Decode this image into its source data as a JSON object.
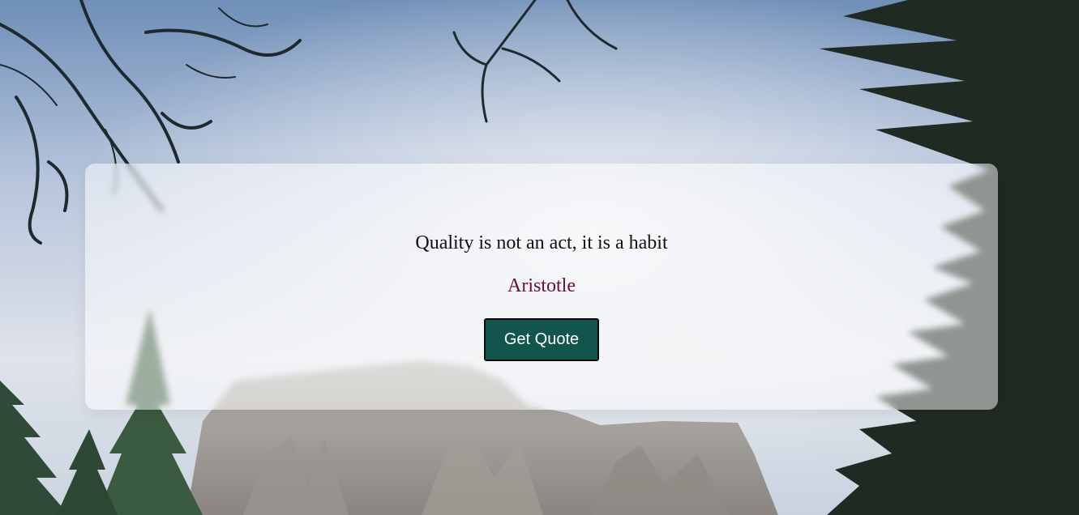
{
  "quote": {
    "text": "Quality is not an act, it is a habit",
    "author": "Aristotle"
  },
  "actions": {
    "get_quote_label": "Get Quote"
  },
  "colors": {
    "button_bg": "#11554d",
    "author_text": "#6b1030",
    "quote_text": "#111111",
    "card_bg": "rgba(255,255,255,0.5)"
  },
  "background": {
    "scene": "mountain-and-pine-trees-photo"
  }
}
